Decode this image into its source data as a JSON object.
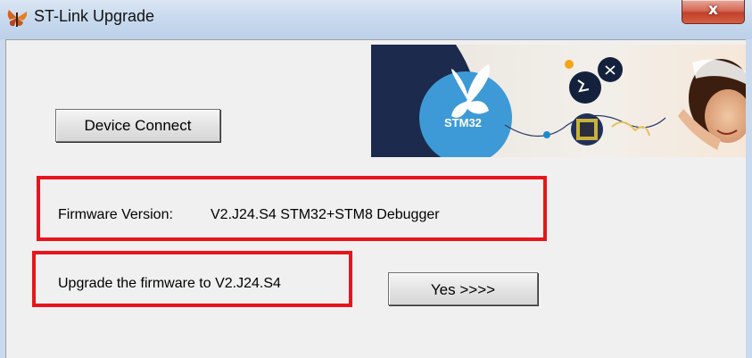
{
  "window": {
    "title": "ST-Link Upgrade",
    "close_label": "x"
  },
  "banner": {
    "logo_text": "STM32"
  },
  "actions": {
    "connect_label": "Device Connect",
    "yes_label": "Yes >>>>"
  },
  "firmware": {
    "version_label": "Firmware Version:",
    "version_value": "V2.J24.S4 STM32+STM8 Debugger",
    "upgrade_text": "Upgrade the firmware to V2.J24.S4"
  },
  "colors": {
    "highlight": "#e8141c",
    "banner_navy": "#1c2a4d",
    "banner_blue": "#3d9ad6"
  }
}
